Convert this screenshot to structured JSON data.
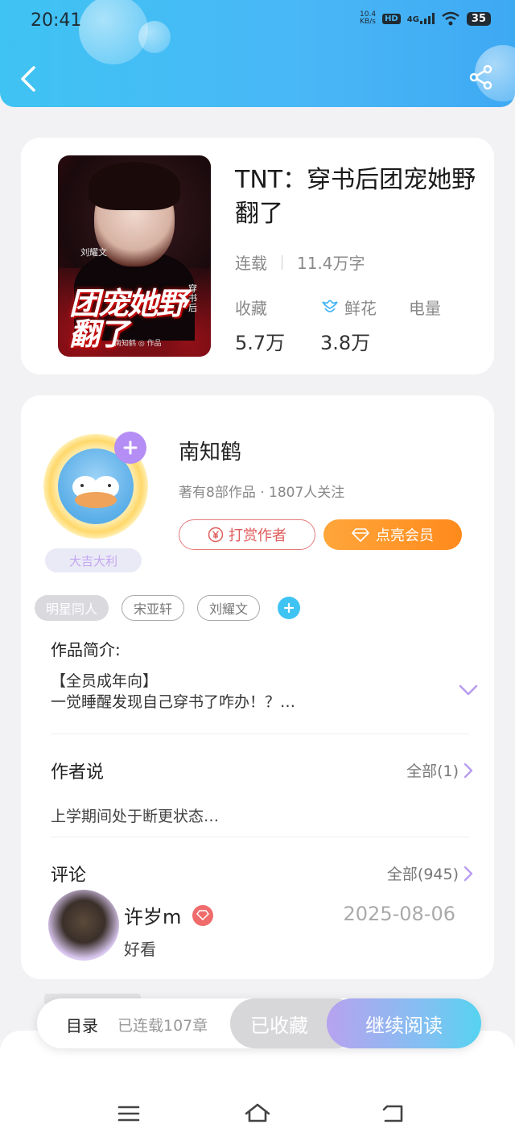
{
  "status_bar": {
    "time": "20:41",
    "net_speed_value": "10.4",
    "net_speed_unit": "KB/s",
    "hd": "HD",
    "signal": "4G",
    "battery": "35"
  },
  "header": {
    "back_icon": "chevron-left-icon",
    "share_icon": "share-icon",
    "color": "#49b7f6"
  },
  "book": {
    "title": "TNT：穿书后团宠她野翻了",
    "status": "连载",
    "word_count": "11.4万字",
    "cover": {
      "big_title": "团宠她野翻了",
      "side_text": "穿书后",
      "star_name": "刘耀文",
      "author_line": "南知鹤 ◎ 作品"
    },
    "stats": [
      {
        "label": "收藏",
        "value": "5.7万"
      },
      {
        "label": "鲜花",
        "value": "3.8万",
        "icon": "flower-icon"
      },
      {
        "label": "电量",
        "value": ""
      }
    ]
  },
  "author": {
    "name": "南知鹤",
    "stats": "著有8部作品 · 1807人关注",
    "badge": "大吉大利",
    "tip_button": "打赏作者",
    "vip_button": "点亮会员"
  },
  "tags": [
    "明星同人",
    "宋亚轩",
    "刘耀文"
  ],
  "intro": {
    "label": "作品简介:",
    "line1": "【全员成年向】",
    "line2": "一觉睡醒发现自己穿书了咋办！？…"
  },
  "author_says": {
    "label": "作者说",
    "more": "全部(1)",
    "text": "上学期间处于断更状态…"
  },
  "comments": {
    "label": "评论",
    "more": "全部(945)",
    "items": [
      {
        "user": "许岁m",
        "date": "2025-08-06",
        "text": "好看"
      }
    ]
  },
  "action_bar": {
    "toc": "目录",
    "toc_count": "已连载107章",
    "collected": "已收藏",
    "continue": "继续阅读"
  },
  "nav": {
    "menu_icon": "menu-icon",
    "home_icon": "home-icon",
    "back_icon": "back-icon"
  }
}
